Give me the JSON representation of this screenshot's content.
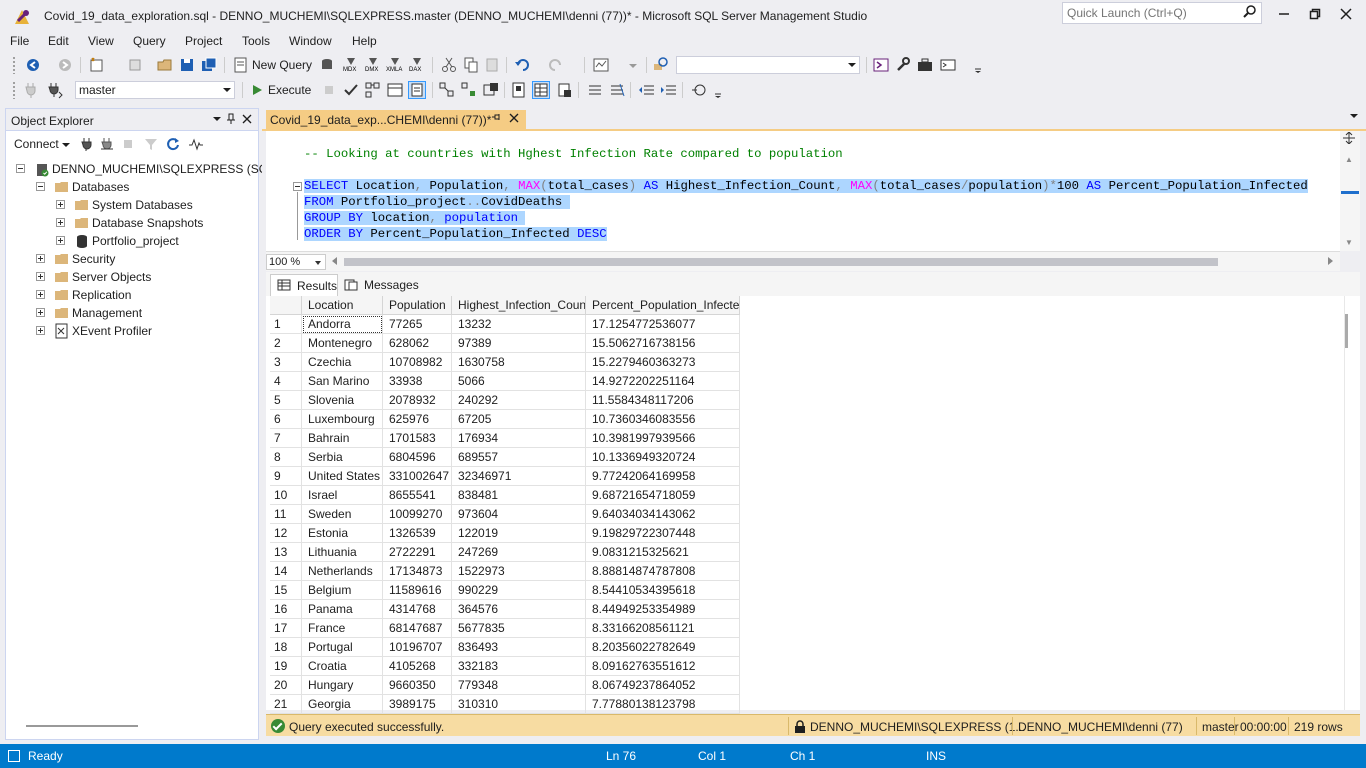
{
  "window": {
    "title": "Covid_19_data_exploration.sql - DENNO_MUCHEMI\\SQLEXPRESS.master (DENNO_MUCHEMI\\denni (77))* - Microsoft SQL Server Management Studio",
    "quick_launch_placeholder": "Quick Launch (Ctrl+Q)"
  },
  "menu": [
    "File",
    "Edit",
    "View",
    "Query",
    "Project",
    "Tools",
    "Window",
    "Help"
  ],
  "toolbar": {
    "new_query_label": "New Query",
    "database_selector": "master",
    "execute_label": "Execute"
  },
  "object_explorer": {
    "title": "Object Explorer",
    "connect_label": "Connect",
    "tree": {
      "server": "DENNO_MUCHEMI\\SQLEXPRESS (SQL",
      "databases": "Databases",
      "system_databases": "System Databases",
      "database_snapshots": "Database Snapshots",
      "portfolio_project": "Portfolio_project",
      "security": "Security",
      "server_objects": "Server Objects",
      "replication": "Replication",
      "management": "Management",
      "xevent_profiler": "XEvent Profiler"
    }
  },
  "editor": {
    "tab_title": "Covid_19_data_exp...CHEMI\\denni (77))*",
    "comment": "-- Looking at countries with Hghest Infection Rate compared to population",
    "zoom": "100 %"
  },
  "results": {
    "tab_results": "Results",
    "tab_messages": "Messages",
    "columns": [
      "Location",
      "Population",
      "Highest_Infection_Count",
      "Percent_Population_Infected"
    ],
    "rows": [
      [
        "1",
        "Andorra",
        "77265",
        "13232",
        "17.1254772536077"
      ],
      [
        "2",
        "Montenegro",
        "628062",
        "97389",
        "15.5062716738156"
      ],
      [
        "3",
        "Czechia",
        "10708982",
        "1630758",
        "15.2279460363273"
      ],
      [
        "4",
        "San Marino",
        "33938",
        "5066",
        "14.9272202251164"
      ],
      [
        "5",
        "Slovenia",
        "2078932",
        "240292",
        "11.5584348117206"
      ],
      [
        "6",
        "Luxembourg",
        "625976",
        "67205",
        "10.7360346083556"
      ],
      [
        "7",
        "Bahrain",
        "1701583",
        "176934",
        "10.3981997939566"
      ],
      [
        "8",
        "Serbia",
        "6804596",
        "689557",
        "10.1336949320724"
      ],
      [
        "9",
        "United States",
        "331002647",
        "32346971",
        "9.77242064169958"
      ],
      [
        "10",
        "Israel",
        "8655541",
        "838481",
        "9.68721654718059"
      ],
      [
        "11",
        "Sweden",
        "10099270",
        "973604",
        "9.64034034143062"
      ],
      [
        "12",
        "Estonia",
        "1326539",
        "122019",
        "9.19829722307448"
      ],
      [
        "13",
        "Lithuania",
        "2722291",
        "247269",
        "9.0831215325621"
      ],
      [
        "14",
        "Netherlands",
        "17134873",
        "1522973",
        "8.88814874787808"
      ],
      [
        "15",
        "Belgium",
        "11589616",
        "990229",
        "8.54410534395618"
      ],
      [
        "16",
        "Panama",
        "4314768",
        "364576",
        "8.44949253354989"
      ],
      [
        "17",
        "France",
        "68147687",
        "5677835",
        "8.33166208561121"
      ],
      [
        "18",
        "Portugal",
        "10196707",
        "836493",
        "8.20356022782649"
      ],
      [
        "19",
        "Croatia",
        "4105268",
        "332183",
        "8.09162763551612"
      ],
      [
        "20",
        "Hungary",
        "9660350",
        "779348",
        "8.06749237864052"
      ],
      [
        "21",
        "Georgia",
        "3989175",
        "310310",
        "7.77880138123798"
      ]
    ]
  },
  "query_status": {
    "message": "Query executed successfully.",
    "server": "DENNO_MUCHEMI\\SQLEXPRESS (1...",
    "user": "DENNO_MUCHEMI\\denni (77)",
    "database": "master",
    "elapsed": "00:00:00",
    "rows": "219 rows"
  },
  "statusbar": {
    "ready": "Ready",
    "line": "Ln 76",
    "col": "Col 1",
    "ch": "Ch 1",
    "mode": "INS"
  },
  "colors": {
    "accent": "#007acc",
    "tab_active": "#f5cc84",
    "query_status": "#f7dca2",
    "selection": "#add6ff",
    "keyword": "#0000ff",
    "function": "#ff00ff",
    "comment": "#008000"
  }
}
